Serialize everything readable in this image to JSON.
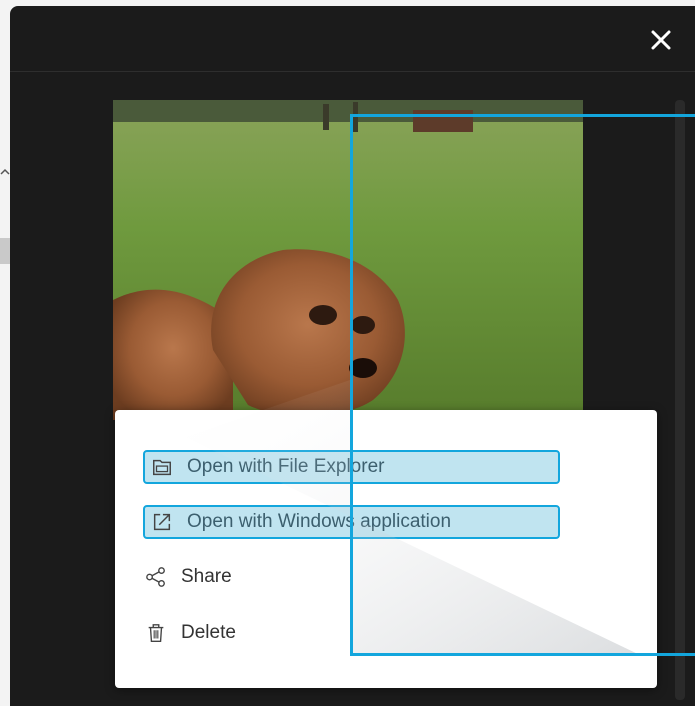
{
  "viewer": {
    "close_icon": "close-icon"
  },
  "menu": {
    "items": [
      {
        "label": "Open with File Explorer",
        "icon": "folder-drive-icon",
        "highlighted": true
      },
      {
        "label": "Open with Windows application",
        "icon": "open-external-icon",
        "highlighted": true
      },
      {
        "label": "Share",
        "icon": "share-icon",
        "highlighted": false
      },
      {
        "label": "Delete",
        "icon": "trash-icon",
        "highlighted": false
      }
    ]
  },
  "colors": {
    "panel": "#1b1b1b",
    "highlight_border": "#13a6dd",
    "highlight_fill": "#bfe5f2"
  }
}
